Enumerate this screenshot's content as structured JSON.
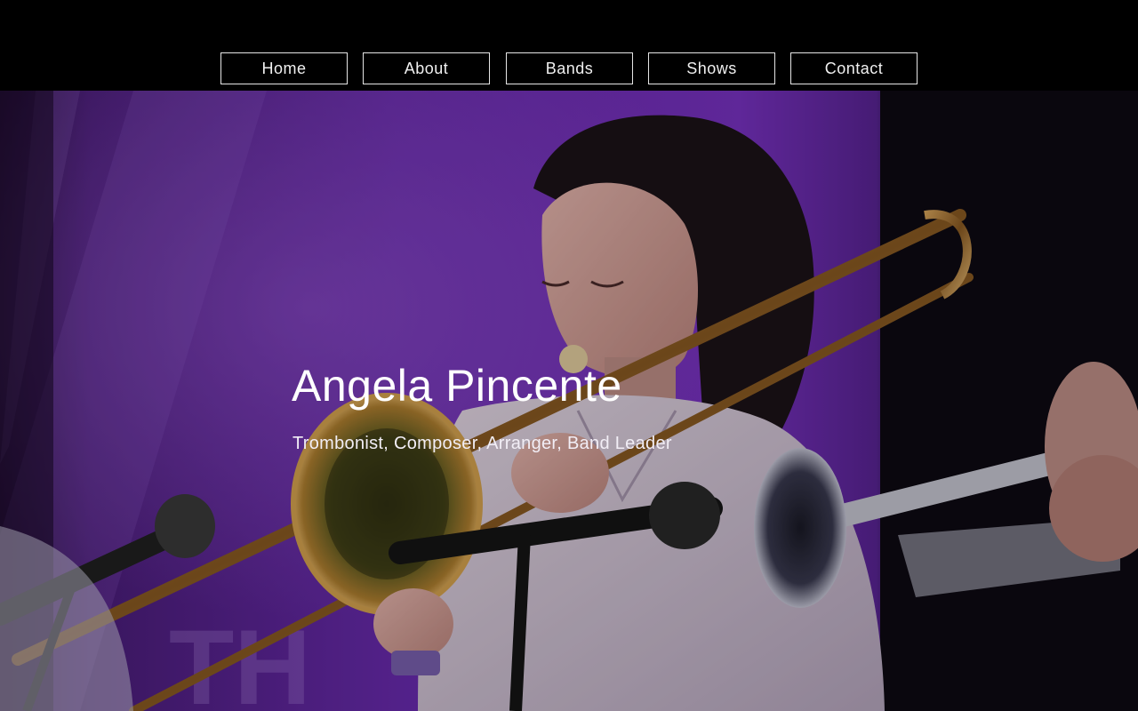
{
  "nav": {
    "items": [
      {
        "label": "Home"
      },
      {
        "label": "About"
      },
      {
        "label": "Bands"
      },
      {
        "label": "Shows"
      },
      {
        "label": "Contact"
      }
    ]
  },
  "hero": {
    "title": "Angela Pincente",
    "subtitle": "Trombonist, Composer, Arranger, Band Leader",
    "image_description_icon": "trombonist-photo"
  },
  "colors": {
    "background": "#000000",
    "nav_text": "#f0f0f0",
    "nav_border": "#e6e6e6",
    "hero_purple": "#7a2fc0"
  }
}
